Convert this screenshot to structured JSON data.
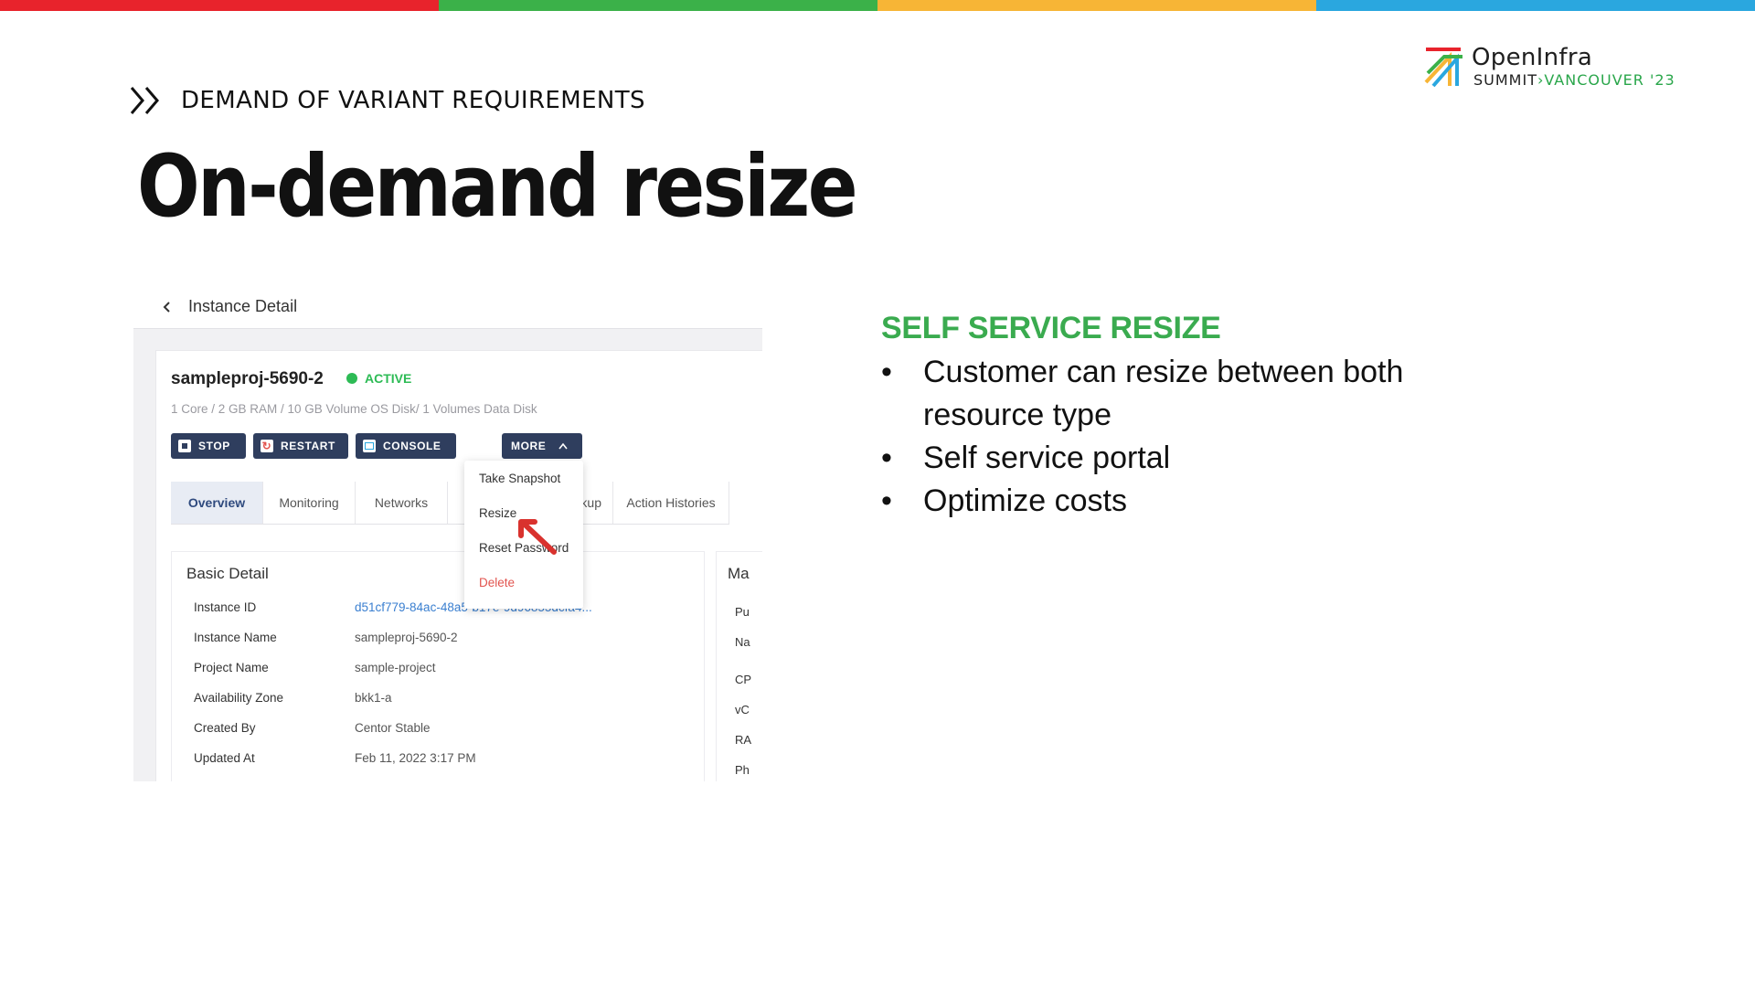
{
  "colors": {
    "bar": [
      "#e8232c",
      "#3bb149",
      "#f7b536",
      "#2aa7df"
    ],
    "accent_green": "#3aab4f",
    "nav_dark": "#2f3e5e",
    "status_green": "#2dbb55",
    "danger": "#e2544f",
    "link": "#3a7fd0"
  },
  "logo": {
    "name": "OpenInfra",
    "sub_left": "SUMMIT",
    "sub_sep": "›",
    "sub_right": "VANCOUVER '23"
  },
  "section": {
    "icon": "double-chevron-right-icon",
    "label": "DEMAND OF VARIANT REQUIREMENTS"
  },
  "title": "On-demand resize",
  "screenshot": {
    "back_label": "Instance Detail",
    "instance": {
      "name": "sampleproj-5690-2",
      "status": "ACTIVE",
      "spec": "1 Core / 2 GB RAM / 10 GB Volume OS Disk/ 1 Volumes Data Disk"
    },
    "buttons": [
      {
        "label": "STOP",
        "icon": "stop-icon"
      },
      {
        "label": "RESTART",
        "icon": "restart-icon"
      },
      {
        "label": "CONSOLE",
        "icon": "console-icon"
      },
      {
        "label": "MORE",
        "icon": "chevron-up-icon"
      }
    ],
    "tabs": [
      "Overview",
      "Monitoring",
      "Networks",
      "",
      "Backup",
      "Action Histories"
    ],
    "dropdown": [
      "Take Snapshot",
      "Resize",
      "Reset Password",
      "Delete"
    ],
    "basic_detail": {
      "title": "Basic Detail",
      "rows": [
        {
          "label": "Instance ID",
          "value": "d51cf779-84ac-48a5-b17e-9d96855dcfa4..."
        },
        {
          "label": "Instance Name",
          "value": "sampleproj-5690-2"
        },
        {
          "label": "Project Name",
          "value": "sample-project"
        },
        {
          "label": "Availability Zone",
          "value": "bkk1-a"
        },
        {
          "label": "Created By",
          "value": "Centor Stable"
        },
        {
          "label": "Updated At",
          "value": "Feb 11, 2022 3:17 PM"
        }
      ]
    },
    "side_panel": {
      "title": "Ma",
      "rows": [
        "Pu",
        "Na",
        "CP",
        "vC",
        "RA",
        "Ph"
      ]
    }
  },
  "right": {
    "heading": "SELF SERVICE RESIZE",
    "bullets": [
      "Customer can resize between both resource type",
      "Self service portal",
      "Optimize costs"
    ]
  }
}
